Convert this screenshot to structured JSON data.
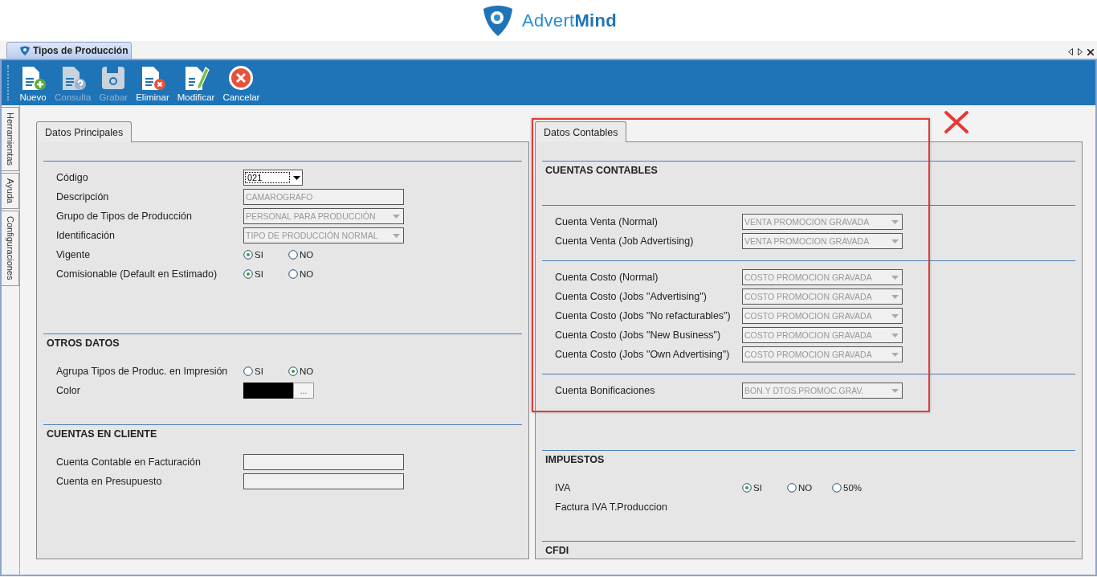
{
  "logo": {
    "text": "Advert**Mind**"
  },
  "document_tab": {
    "title": "Tipos de Producción"
  },
  "toolbar": [
    {
      "kind": "new",
      "label": "Nuevo",
      "disabled": false
    },
    {
      "kind": "query",
      "label": "Consulta",
      "disabled": true
    },
    {
      "kind": "save",
      "label": "Grabar",
      "disabled": true
    },
    {
      "kind": "delete",
      "label": "Eliminar",
      "disabled": false
    },
    {
      "kind": "edit",
      "label": "Modificar",
      "disabled": false
    },
    {
      "kind": "cancel",
      "label": "Cancelar",
      "disabled": false
    }
  ],
  "side_tabs": [
    "Herramientas",
    "Ayuda",
    "Configuraciones"
  ],
  "left_panel": {
    "tab": "Datos Principales",
    "sections": [
      {
        "rows": [
          {
            "kind": "combo",
            "label": "Código",
            "value": "021"
          },
          {
            "kind": "text",
            "label": "Descripción",
            "value": "CAMAROGRAFO"
          },
          {
            "kind": "select",
            "label": "Grupo de Tipos de Producción",
            "value": "PERSONAL PARA PRODUCCIÓN"
          },
          {
            "kind": "select",
            "label": "Identificación",
            "value": "TIPO DE PRODUCCIÓN NORMAL"
          },
          {
            "kind": "radio",
            "label": "Vigente",
            "options": [
              {
                "label": "SI",
                "selected": true
              },
              {
                "label": "NO",
                "selected": false
              }
            ]
          },
          {
            "kind": "radio",
            "label": "Comisionable (Default en Estimado)",
            "options": [
              {
                "label": "SI",
                "selected": true
              },
              {
                "label": "NO",
                "selected": false
              }
            ]
          }
        ]
      },
      {
        "title": "OTROS DATOS",
        "rows": [
          {
            "kind": "radio",
            "label": "Agrupa Tipos de Produc. en Impresión",
            "options": [
              {
                "label": "SI",
                "selected": false
              },
              {
                "label": "NO",
                "selected": true
              }
            ]
          },
          {
            "kind": "color",
            "label": "Color",
            "color": "#000000",
            "button_label": "..."
          }
        ]
      },
      {
        "title": "CUENTAS EN CLIENTE",
        "rows": [
          {
            "kind": "text",
            "label": "Cuenta Contable en Facturación"
          },
          {
            "kind": "text",
            "label": "Cuenta en Presupuesto"
          }
        ]
      }
    ]
  },
  "right_panel": {
    "tab": "Datos Contables",
    "sections": [
      {
        "title": "CUENTAS CONTABLES"
      },
      {
        "rows": [
          {
            "kind": "select",
            "label": "Cuenta Venta (Normal)",
            "value": "VENTA PROMOCION GRAVADA"
          },
          {
            "kind": "select",
            "label": "Cuenta Venta (Job Advertising)",
            "value": "VENTA PROMOCION GRAVADA"
          }
        ]
      },
      {
        "rows": [
          {
            "kind": "select",
            "label": "Cuenta Costo (Normal)",
            "value": "COSTO PROMOCION GRAVADA"
          },
          {
            "kind": "select",
            "label": "Cuenta Costo (Jobs \"Advertising\")",
            "value": "COSTO PROMOCION GRAVADA"
          },
          {
            "kind": "select",
            "label": "Cuenta Costo (Jobs \"No refacturables\")",
            "value": "COSTO PROMOCION GRAVADA"
          },
          {
            "kind": "select",
            "label": "Cuenta Costo (Jobs \"New Business\")",
            "value": "COSTO PROMOCION GRAVADA"
          },
          {
            "kind": "select",
            "label": "Cuenta Costo (Jobs \"Own Advertising\")",
            "value": "COSTO PROMOCION GRAVADA"
          }
        ]
      },
      {
        "rows": [
          {
            "kind": "select",
            "label": "Cuenta Bonificaciones",
            "value": "BON.Y DTOS.PROMOC.GRAV."
          }
        ]
      },
      {
        "title": "IMPUESTOS",
        "rows": [
          {
            "kind": "radio",
            "label": "IVA",
            "options": [
              {
                "label": "SI",
                "selected": true
              },
              {
                "label": "NO",
                "selected": false
              },
              {
                "label": "50%",
                "selected": false
              }
            ]
          },
          {
            "kind": "label",
            "label": "Factura IVA T.Produccion"
          }
        ]
      },
      {
        "title": "CFDI"
      }
    ]
  }
}
